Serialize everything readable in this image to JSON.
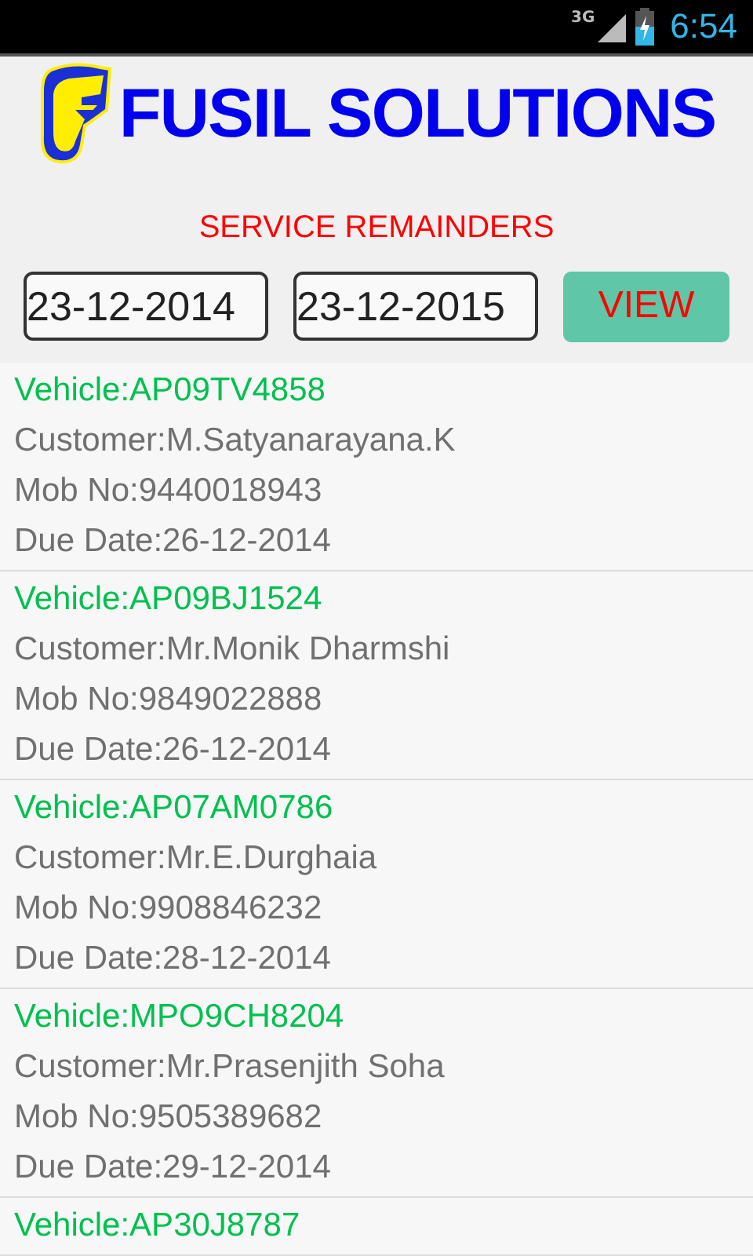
{
  "status_bar": {
    "network": "3G",
    "time": "6:54"
  },
  "header": {
    "brand": "FUSIL SOLUTIONS",
    "title": "SERVICE REMAINDERS"
  },
  "filters": {
    "from_date": "23-12-2014",
    "to_date": "23-12-2015",
    "button": "VIEW"
  },
  "reminders": [
    {
      "vehicle": "Vehicle:AP09TV4858",
      "customer": "Customer:M.Satyanarayana.K",
      "mobile": "Mob No:9440018943",
      "due_date": "Due Date:26-12-2014"
    },
    {
      "vehicle": "Vehicle:AP09BJ1524",
      "customer": "Customer:Mr.Monik Dharmshi",
      "mobile": "Mob No:9849022888",
      "due_date": "Due Date:26-12-2014"
    },
    {
      "vehicle": "Vehicle:AP07AM0786",
      "customer": "Customer:Mr.E.Durghaia",
      "mobile": "Mob No:9908846232",
      "due_date": "Due Date:28-12-2014"
    },
    {
      "vehicle": "Vehicle:MPO9CH8204",
      "customer": "Customer:Mr.Prasenjith Soha",
      "mobile": "Mob No:9505389682",
      "due_date": "Due Date:29-12-2014"
    },
    {
      "vehicle": "Vehicle:AP30J8787"
    }
  ]
}
